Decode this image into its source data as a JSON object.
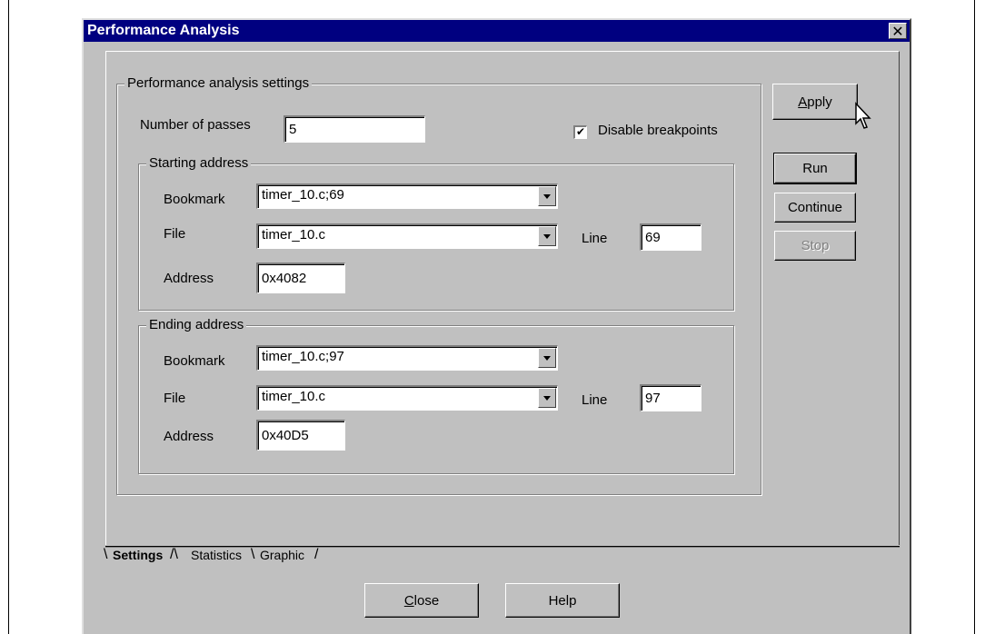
{
  "dialog": {
    "title": "Performance Analysis",
    "close_glyph": "✕"
  },
  "settings_group": {
    "label": "Performance analysis settings",
    "passes_label": "Number of passes",
    "passes_value": "5",
    "disable_breakpoints_label": "Disable breakpoints",
    "disable_breakpoints_checked": true,
    "check_glyph": "✔"
  },
  "starting": {
    "label": "Starting address",
    "bookmark_label": "Bookmark",
    "bookmark_value": "timer_10.c;69",
    "file_label": "File",
    "file_value": "timer_10.c",
    "line_label": "Line",
    "line_value": "69",
    "address_label": "Address",
    "address_value": "0x4082"
  },
  "ending": {
    "label": "Ending address",
    "bookmark_label": "Bookmark",
    "bookmark_value": "timer_10.c;97",
    "file_label": "File",
    "file_value": "timer_10.c",
    "line_label": "Line",
    "line_value": "97",
    "address_label": "Address",
    "address_value": "0x40D5"
  },
  "buttons": {
    "apply_mnemonic": "A",
    "apply_rest": "pply",
    "run": "Run",
    "continue": "Continue",
    "stop": "Stop",
    "close_mnemonic": "C",
    "close_rest": "lose",
    "help": "Help"
  },
  "tabs": [
    {
      "label": "Settings",
      "active": true
    },
    {
      "label": "Statistics",
      "active": false
    },
    {
      "label": "Graphic",
      "active": false
    }
  ],
  "colors": {
    "titlebar": "#000080",
    "face": "#c0c0c0"
  }
}
